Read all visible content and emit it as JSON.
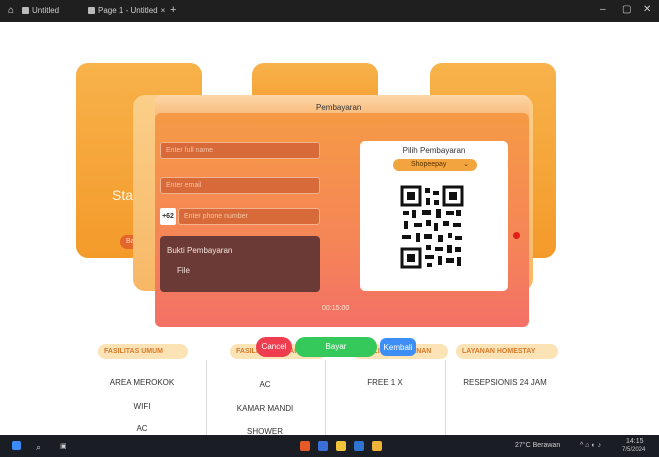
{
  "browser": {
    "tabs": [
      {
        "label": "Untitled"
      },
      {
        "label": "Page 1 - Untitled"
      }
    ],
    "new_tab": "+",
    "controls": {
      "minimize": "–",
      "restore": "▢",
      "close": "✕"
    }
  },
  "background": {
    "card_text": "Stand",
    "card_pill": "Bay"
  },
  "modal": {
    "title": "Pembayaran",
    "full_name_placeholder": "Enter full name",
    "email_placeholder": "Enter email",
    "phone_code": "+62",
    "phone_placeholder": "Enter phone number",
    "proof_label": "Bukti Pembayaran",
    "file_label": "File",
    "timer": "00:15:00",
    "payment": {
      "title": "Pilih Pembayaran",
      "selected": "Shopeepay"
    }
  },
  "buttons": {
    "cancel": "Cancel",
    "pay": "Bayar",
    "back": "Kembali"
  },
  "facilities": [
    {
      "header": "FASILITAS UMUM",
      "items": [
        "AREA MEROKOK",
        "WIFI",
        "AC"
      ]
    },
    {
      "header": "FASILITAS KAMAR",
      "items": [
        "AC",
        "KAMAR MANDI",
        "SHOWER"
      ]
    },
    {
      "header": "FASILITAS MAKANAN",
      "items": [
        "FREE 1 X"
      ]
    },
    {
      "header": "LAYANAN HOMESTAY",
      "items": [
        "RESEPSIONIS 24 JAM"
      ]
    }
  ],
  "taskbar": {
    "weather": "27°C Berawan",
    "time": "14:15",
    "date": "7/5/2024"
  },
  "colors": {
    "accent": "#f49a2a",
    "cancel": "#ee3d4e",
    "pay": "#35c85a",
    "back": "#3d8ef5"
  }
}
